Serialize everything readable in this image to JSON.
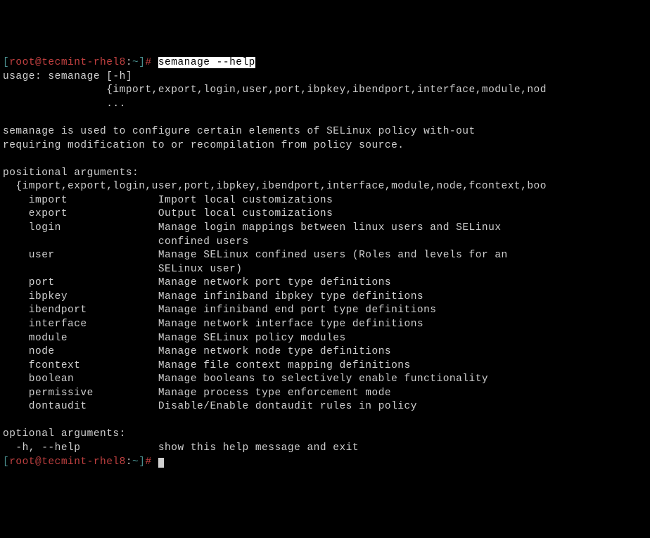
{
  "prompt": {
    "bracket_open": "[",
    "user_host": "root@tecmint-rhel8",
    "colon": ":",
    "path": "~",
    "bracket_close": "]",
    "hash": "# "
  },
  "command": "semanage --help",
  "usage_line": "usage: semanage [-h]",
  "usage_sub": "                {import,export,login,user,port,ibpkey,ibendport,interface,module,nod",
  "usage_dots": "                ...",
  "description_line1": "semanage is used to configure certain elements of SELinux policy with-out",
  "description_line2": "requiring modification to or recompilation from policy source.",
  "positional_header": "positional arguments:",
  "positional_list": "  {import,export,login,user,port,ibpkey,ibendport,interface,module,node,fcontext,boo",
  "args": [
    {
      "name": "    import",
      "desc": "              Import local customizations"
    },
    {
      "name": "    export",
      "desc": "              Output local customizations"
    },
    {
      "name": "    login",
      "desc": "               Manage login mappings between linux users and SELinux"
    },
    {
      "name": "",
      "desc": "                        confined users"
    },
    {
      "name": "    user",
      "desc": "                Manage SELinux confined users (Roles and levels for an"
    },
    {
      "name": "",
      "desc": "                        SELinux user)"
    },
    {
      "name": "    port",
      "desc": "                Manage network port type definitions"
    },
    {
      "name": "    ibpkey",
      "desc": "              Manage infiniband ibpkey type definitions"
    },
    {
      "name": "    ibendport",
      "desc": "           Manage infiniband end port type definitions"
    },
    {
      "name": "    interface",
      "desc": "           Manage network interface type definitions"
    },
    {
      "name": "    module",
      "desc": "              Manage SELinux policy modules"
    },
    {
      "name": "    node",
      "desc": "                Manage network node type definitions"
    },
    {
      "name": "    fcontext",
      "desc": "            Manage file context mapping definitions"
    },
    {
      "name": "    boolean",
      "desc": "             Manage booleans to selectively enable functionality"
    },
    {
      "name": "    permissive",
      "desc": "          Manage process type enforcement mode"
    },
    {
      "name": "    dontaudit",
      "desc": "           Disable/Enable dontaudit rules in policy"
    }
  ],
  "optional_header": "optional arguments:",
  "optional_arg": {
    "name": "  -h, --help",
    "desc": "            show this help message and exit"
  }
}
